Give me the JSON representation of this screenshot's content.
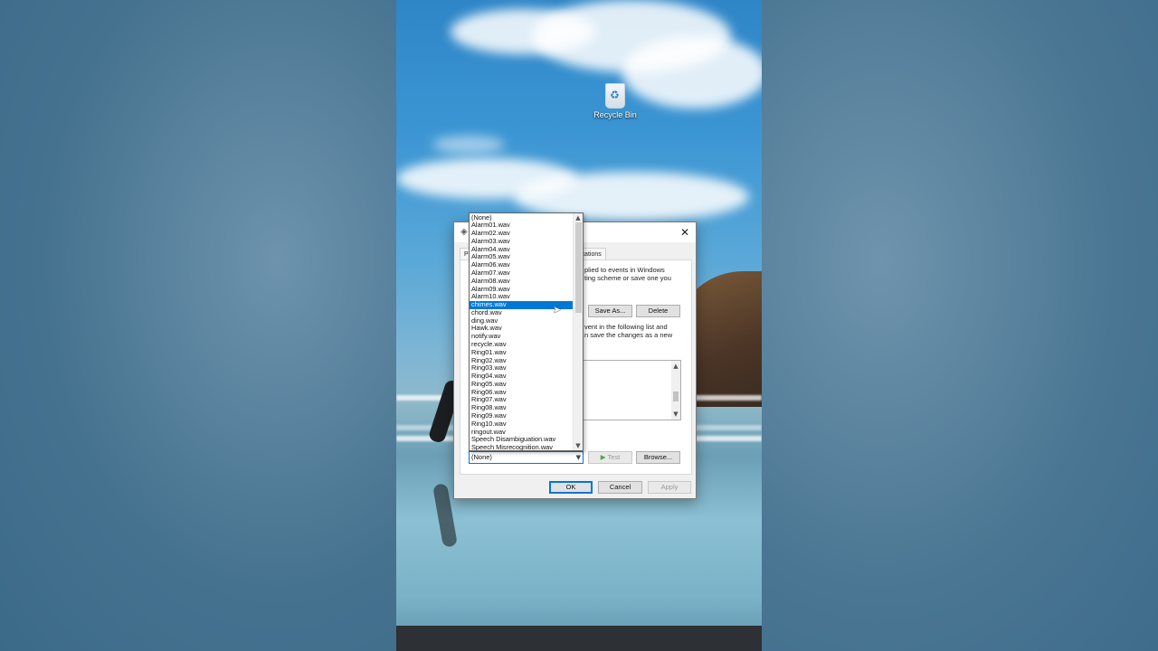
{
  "desktop": {
    "recycle_bin_label": "Recycle Bin"
  },
  "dialog": {
    "close_glyph": "✕",
    "tabs": [
      {
        "label": "Pla"
      },
      {
        "label": "ications"
      }
    ],
    "description_1": [
      "plied to events in Windows",
      "ting scheme or save one you"
    ],
    "description_2": [
      "vent in the following list and",
      "n save the changes as a new"
    ],
    "buttons": {
      "save_as": "Save As...",
      "delete": "Delete",
      "test": "Test",
      "browse": "Browse...",
      "ok": "OK",
      "cancel": "Cancel",
      "apply": "Apply"
    },
    "sounds_combo": {
      "value": "(None)"
    },
    "sounds_dropdown": {
      "selected_index": 11,
      "options": [
        "(None)",
        "Alarm01.wav",
        "Alarm02.wav",
        "Alarm03.wav",
        "Alarm04.wav",
        "Alarm05.wav",
        "Alarm06.wav",
        "Alarm07.wav",
        "Alarm08.wav",
        "Alarm09.wav",
        "Alarm10.wav",
        "chimes.wav",
        "chord.wav",
        "ding.wav",
        "Hawk.wav",
        "notify.wav",
        "recycle.wav",
        "Ring01.wav",
        "Ring02.wav",
        "Ring03.wav",
        "Ring04.wav",
        "Ring05.wav",
        "Ring06.wav",
        "Ring07.wav",
        "Ring08.wav",
        "Ring09.wav",
        "Ring10.wav",
        "ringout.wav",
        "Speech Disambiguation.wav",
        "Speech Misrecognition.wav"
      ]
    }
  },
  "icons": {
    "up_arrow": "▲",
    "down_arrow": "▼",
    "play": "▶",
    "cursor": "➤"
  }
}
